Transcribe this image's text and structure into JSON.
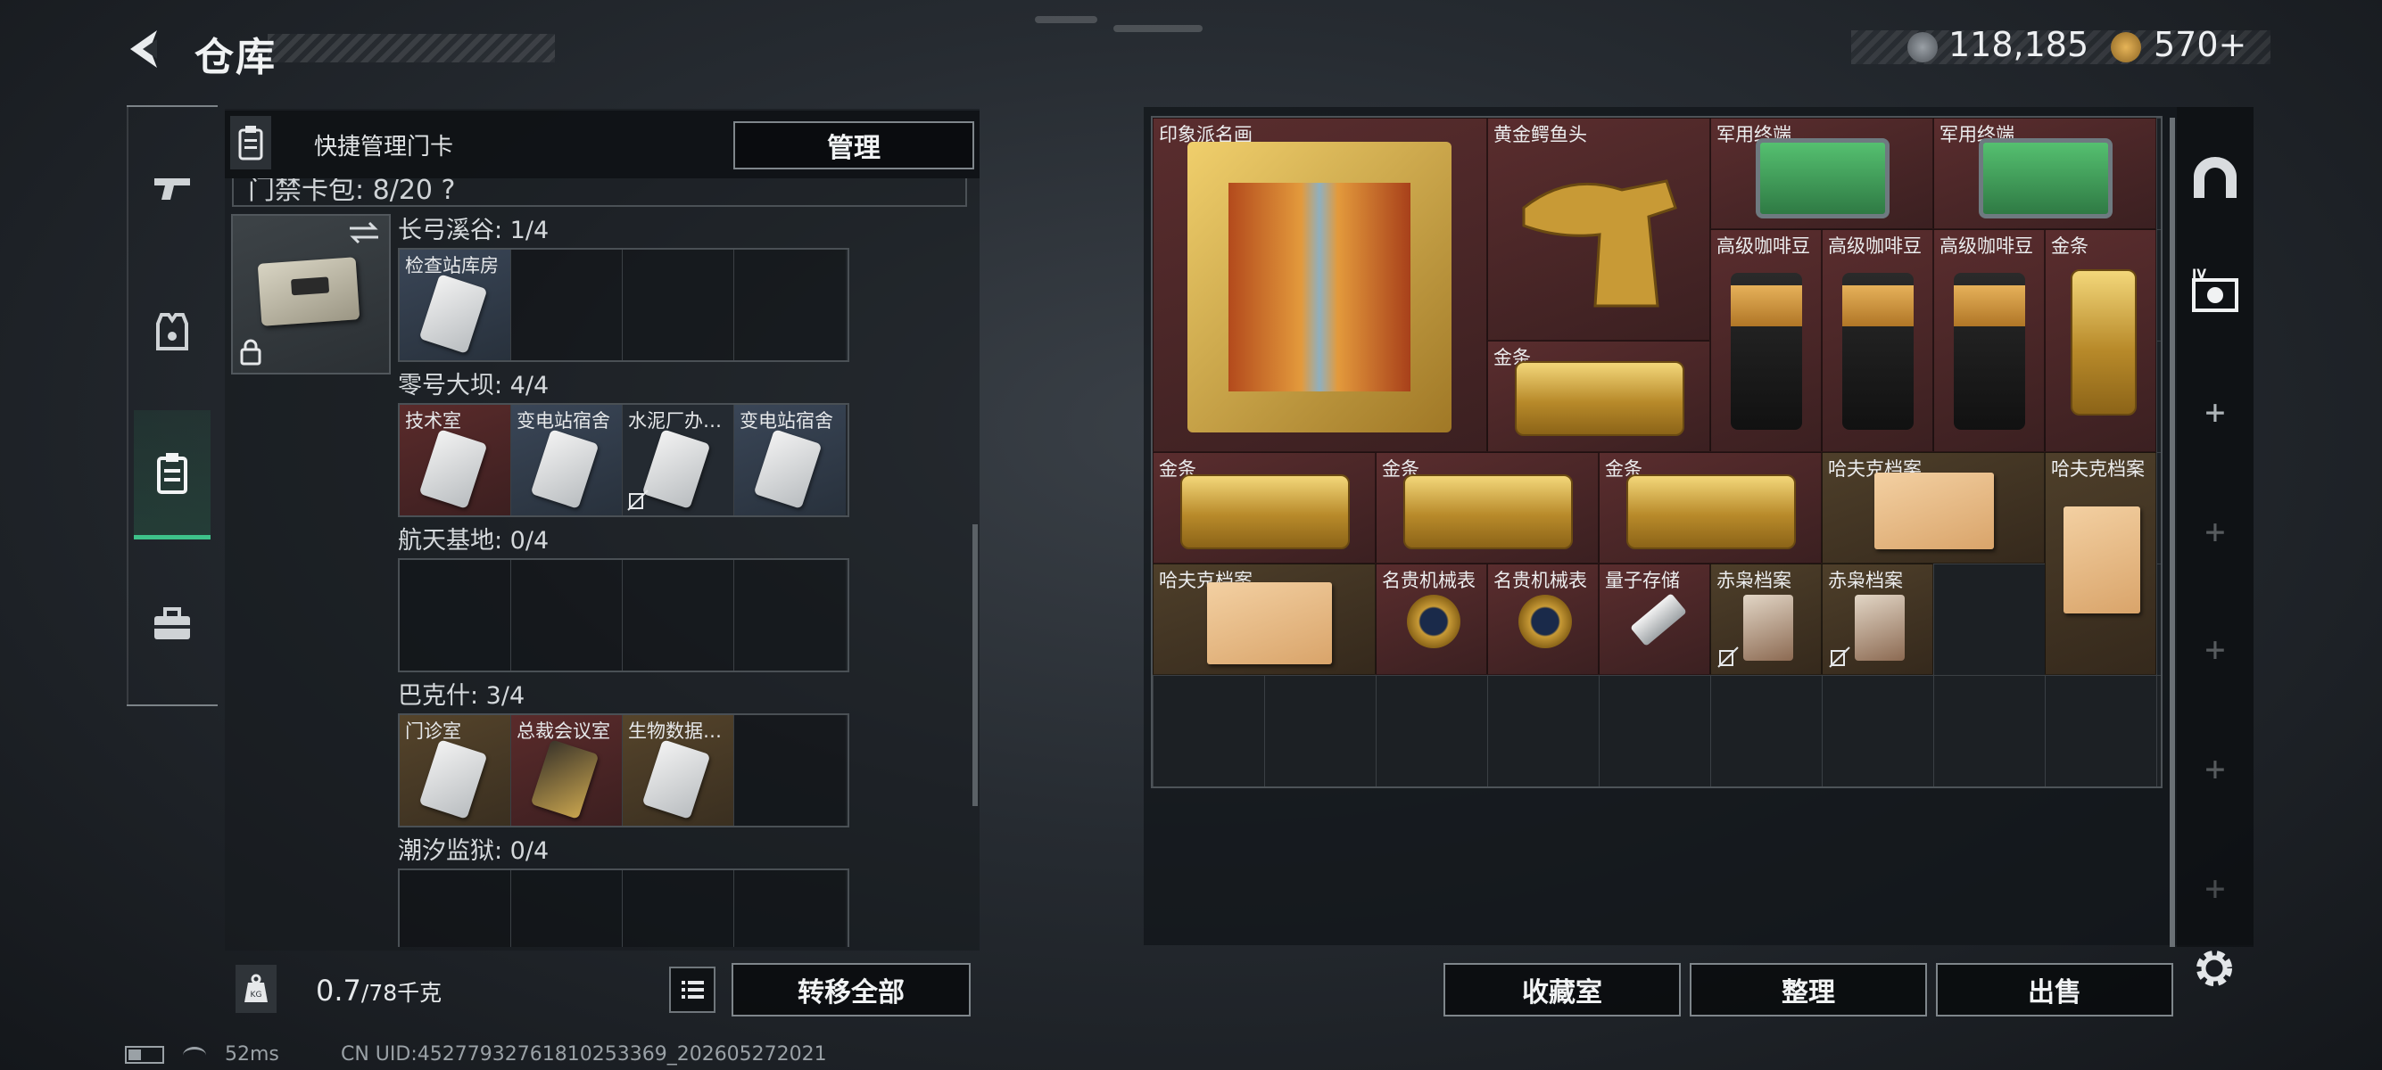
{
  "header": {
    "title": "仓库",
    "currency_1": "118,185",
    "currency_2": "570+"
  },
  "rail": {
    "items": [
      "weapon-icon",
      "armor-icon",
      "keycard-icon",
      "toolbox-icon"
    ]
  },
  "keycard_panel": {
    "header_label": "快捷管理门卡",
    "manage_label": "管理",
    "pack_label": "门禁卡包: 8/20 ?",
    "zones": [
      {
        "label": "长弓溪谷: 1/4",
        "slots": [
          {
            "name": "检查站库房",
            "style": "blue"
          },
          {
            "name": "",
            "style": "empty"
          },
          {
            "name": "",
            "style": "empty"
          },
          {
            "name": "",
            "style": "empty"
          }
        ]
      },
      {
        "label": "零号大坝: 4/4",
        "slots": [
          {
            "name": "技术室",
            "style": "red"
          },
          {
            "name": "变电站宿舍",
            "style": "blue"
          },
          {
            "name": "水泥厂办…",
            "style": "empty"
          },
          {
            "name": "变电站宿舍",
            "style": "blue"
          }
        ]
      },
      {
        "label": "航天基地: 0/4",
        "slots": []
      },
      {
        "label": "巴克什: 3/4",
        "slots": [
          {
            "name": "门诊室",
            "style": "gold"
          },
          {
            "name": "总裁会议室",
            "style": "red"
          },
          {
            "name": "生物数据…",
            "style": "gold"
          },
          {
            "name": "",
            "style": "empty"
          }
        ]
      },
      {
        "label": "潮汐监狱: 0/4",
        "slots": []
      }
    ]
  },
  "footer_left": {
    "weight_value": "0.7",
    "weight_max": "/78千克",
    "transfer_label": "转移全部"
  },
  "status": {
    "latency": "52ms",
    "uid": "CN UID:4527793276181025336​9_202605272021"
  },
  "stash": {
    "items": [
      {
        "name": "印象派名画",
        "style": "red"
      },
      {
        "name": "黄金鳄鱼头",
        "style": "red"
      },
      {
        "name": "军用终端",
        "style": "red"
      },
      {
        "name": "军用终端",
        "style": "red"
      },
      {
        "name": "高级咖啡豆",
        "style": "red"
      },
      {
        "name": "高级咖啡豆",
        "style": "red"
      },
      {
        "name": "高级咖啡豆",
        "style": "red"
      },
      {
        "name": "金条",
        "style": "red"
      },
      {
        "name": "金条",
        "style": "red"
      },
      {
        "name": "金条",
        "style": "red"
      },
      {
        "name": "金条",
        "style": "red"
      },
      {
        "name": "金条",
        "style": "red"
      },
      {
        "name": "哈夫克档案",
        "style": "gold"
      },
      {
        "name": "哈夫克档案",
        "style": "gold"
      },
      {
        "name": "哈夫克档案",
        "style": "gold"
      },
      {
        "name": "名贵机械表",
        "style": "red"
      },
      {
        "name": "名贵机械表",
        "style": "red"
      },
      {
        "name": "量子存储",
        "style": "red"
      },
      {
        "name": "赤枭档案",
        "style": "gold"
      },
      {
        "name": "赤枭档案",
        "style": "gold"
      }
    ]
  },
  "bottom_buttons": {
    "collection": "收藏室",
    "sort": "整理",
    "sell": "出售"
  }
}
